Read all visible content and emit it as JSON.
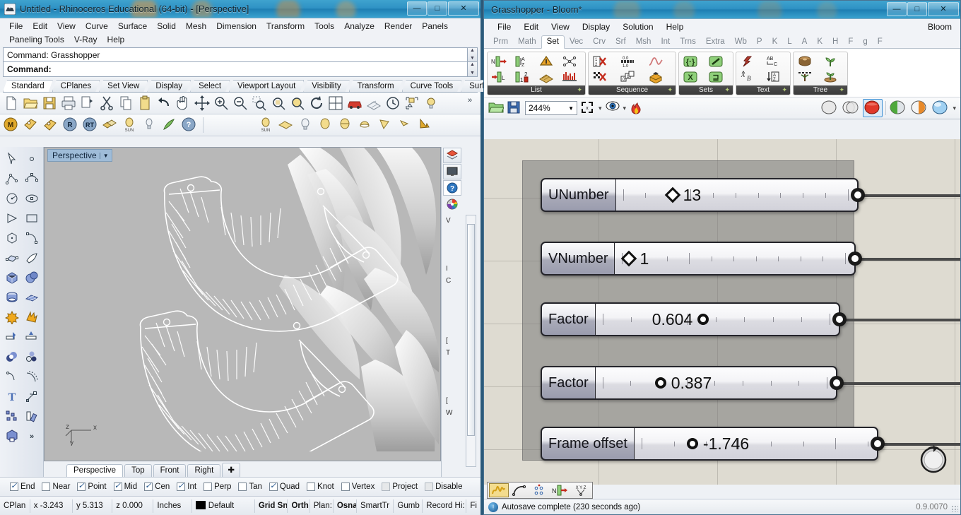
{
  "rhino": {
    "window_title": "Untitled - Rhinoceros Educational (64-bit) - [Perspective]",
    "window_buttons": {
      "minimize": "—",
      "maximize": "□",
      "close": "✕"
    },
    "menus_row1": [
      "File",
      "Edit",
      "View",
      "Curve",
      "Surface",
      "Solid",
      "Mesh",
      "Dimension",
      "Transform",
      "Tools",
      "Analyze",
      "Render",
      "Panels"
    ],
    "menus_row2": [
      "Paneling Tools",
      "V-Ray",
      "Help"
    ],
    "command_history": "Command: Grasshopper",
    "command_prompt": "Command:",
    "toolbar_tabs": [
      "Standard",
      "CPlanes",
      "Set View",
      "Display",
      "Select",
      "Viewport Layout",
      "Visibility",
      "Transform",
      "Curve Tools",
      "Surface T"
    ],
    "toolbar_tabs_overflow": "»",
    "toolbar_tab_active": "Standard",
    "viewport": {
      "label": "Perspective",
      "axis": {
        "x": "x",
        "y": "y",
        "z": "z"
      }
    },
    "viewport_tabs": [
      "Perspective",
      "Top",
      "Front",
      "Right"
    ],
    "viewport_tab_active": "Perspective",
    "viewport_tab_add": "✚",
    "right_panel_letters": [
      "V",
      "",
      "",
      "",
      "I",
      "C",
      "",
      "",
      "",
      "[",
      "T",
      "",
      "",
      "[",
      "W"
    ],
    "osnaps": [
      {
        "label": "End",
        "checked": true,
        "disabled": false
      },
      {
        "label": "Near",
        "checked": false,
        "disabled": false
      },
      {
        "label": "Point",
        "checked": true,
        "disabled": false
      },
      {
        "label": "Mid",
        "checked": true,
        "disabled": false
      },
      {
        "label": "Cen",
        "checked": true,
        "disabled": false
      },
      {
        "label": "Int",
        "checked": true,
        "disabled": false
      },
      {
        "label": "Perp",
        "checked": false,
        "disabled": false
      },
      {
        "label": "Tan",
        "checked": false,
        "disabled": false
      },
      {
        "label": "Quad",
        "checked": true,
        "disabled": false
      },
      {
        "label": "Knot",
        "checked": false,
        "disabled": false
      },
      {
        "label": "Vertex",
        "checked": false,
        "disabled": false
      },
      {
        "label": "Project",
        "checked": false,
        "disabled": true
      },
      {
        "label": "Disable",
        "checked": false,
        "disabled": true
      }
    ],
    "statusbar": {
      "cplane": "CPlan",
      "x": "x -3.243",
      "y": "y 5.313",
      "z": "z 0.000",
      "units": "Inches",
      "layer": "Default",
      "toggles": [
        "Grid Sn",
        "Orth",
        "Plan:",
        "Osna",
        "SmartTr",
        "Gumb",
        "Record Hi:",
        "Fi"
      ]
    }
  },
  "grasshopper": {
    "window_title": "Grasshopper - Bloom*",
    "window_buttons": {
      "minimize": "—",
      "maximize": "□",
      "close": "✕"
    },
    "menus": [
      "File",
      "Edit",
      "View",
      "Display",
      "Solution",
      "Help"
    ],
    "menu_right": "Bloom",
    "tabs": [
      "Prm",
      "Math",
      "Set",
      "Vec",
      "Crv",
      "Srf",
      "Msh",
      "Int",
      "Trns",
      "Extra",
      "Wb",
      "P",
      "K",
      "L",
      "A",
      "K",
      "H",
      "F",
      "g",
      "F"
    ],
    "tab_active": "Set",
    "ribbon_groups": [
      {
        "name": "List",
        "pin": "✦"
      },
      {
        "name": "Sequence",
        "pin": "✦"
      },
      {
        "name": "Sets",
        "pin": "✦"
      },
      {
        "name": "Text",
        "pin": "✦"
      },
      {
        "name": "Tree",
        "pin": "✦"
      }
    ],
    "canvas_toolbar": {
      "open_icon": "open-folder-icon",
      "save_icon": "save-disk-icon",
      "zoom_value": "244%",
      "zoom_caret": "▼",
      "zoom_extents_icon": "zoom-extents-icon",
      "preview_icon": "eye-preview-icon",
      "bake_icon": "flame-icon",
      "dropdown_caret": "▾"
    },
    "sliders": [
      {
        "name": "UNumber",
        "value": "13",
        "knob": "diamond",
        "knob_pct": 30,
        "value_side": "right",
        "ticks": 11
      },
      {
        "name": "VNumber",
        "value": "1",
        "knob": "diamond",
        "knob_pct": 4,
        "value_side": "right",
        "ticks": 11
      },
      {
        "name": "Factor",
        "value": "0.604",
        "knob": "circle",
        "knob_pct": 60,
        "value_side": "left",
        "ticks": 9
      },
      {
        "name": "Factor",
        "value": "0.387",
        "knob": "circle",
        "knob_pct": 38,
        "value_side": "right",
        "ticks": 9
      },
      {
        "name": "Frame offset",
        "value": "-1.746",
        "knob": "circle",
        "knob_pct": 30,
        "value_side": "right",
        "ticks": 8
      }
    ],
    "status": {
      "message": "Autosave complete (230 seconds ago)",
      "version": "0.9.0070",
      "icon": "info-icon"
    },
    "mode_icons": [
      "squiggle-icon",
      "curve-point-icon",
      "points-grid-icon",
      "number-to-arrow-icon",
      "xyz-icon"
    ],
    "mode_selected": "squiggle-icon"
  },
  "colors": {
    "gh_canvas": "#dedbd1",
    "gh_group": "#8a8a8a",
    "rhino_viewport": "#b8b8b8",
    "titlebar_accent": "#2f92c4",
    "slider_name_bg": "#a9aab8",
    "wire": "#4a4a4a"
  }
}
